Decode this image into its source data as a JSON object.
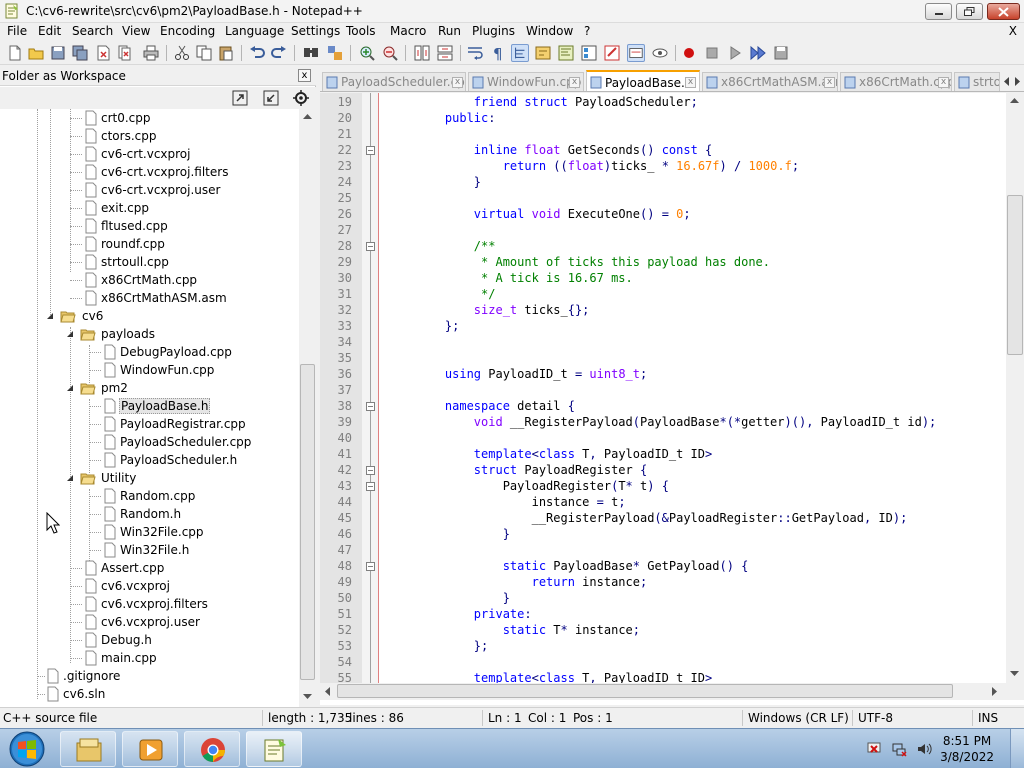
{
  "window": {
    "title": "C:\\cv6-rewrite\\src\\cv6\\pm2\\PayloadBase.h - Notepad++"
  },
  "menu": {
    "items": [
      "File",
      "Edit",
      "Search",
      "View",
      "Encoding",
      "Language",
      "Settings",
      "Tools",
      "Macro",
      "Run",
      "Plugins",
      "Window",
      "?"
    ],
    "close_label": "X"
  },
  "panel": {
    "title": "Folder as Workspace",
    "close_label": "x",
    "tree": [
      {
        "label": "crt0.cpp",
        "type": "file"
      },
      {
        "label": "ctors.cpp",
        "type": "file"
      },
      {
        "label": "cv6-crt.vcxproj",
        "type": "file"
      },
      {
        "label": "cv6-crt.vcxproj.filters",
        "type": "file"
      },
      {
        "label": "cv6-crt.vcxproj.user",
        "type": "file"
      },
      {
        "label": "exit.cpp",
        "type": "file"
      },
      {
        "label": "fltused.cpp",
        "type": "file"
      },
      {
        "label": "roundf.cpp",
        "type": "file"
      },
      {
        "label": "strtoull.cpp",
        "type": "file"
      },
      {
        "label": "x86CrtMath.cpp",
        "type": "file"
      },
      {
        "label": "x86CrtMathASM.asm",
        "type": "file"
      },
      {
        "label": "cv6",
        "type": "folder"
      },
      {
        "label": "payloads",
        "type": "folder"
      },
      {
        "label": "DebugPayload.cpp",
        "type": "file"
      },
      {
        "label": "WindowFun.cpp",
        "type": "file"
      },
      {
        "label": "pm2",
        "type": "folder"
      },
      {
        "label": "PayloadBase.h",
        "type": "file",
        "selected": true
      },
      {
        "label": "PayloadRegistrar.cpp",
        "type": "file"
      },
      {
        "label": "PayloadScheduler.cpp",
        "type": "file"
      },
      {
        "label": "PayloadScheduler.h",
        "type": "file"
      },
      {
        "label": "Utility",
        "type": "folder"
      },
      {
        "label": "Random.cpp",
        "type": "file"
      },
      {
        "label": "Random.h",
        "type": "file"
      },
      {
        "label": "Win32File.cpp",
        "type": "file"
      },
      {
        "label": "Win32File.h",
        "type": "file"
      },
      {
        "label": "Assert.cpp",
        "type": "file"
      },
      {
        "label": "cv6.vcxproj",
        "type": "file"
      },
      {
        "label": "cv6.vcxproj.filters",
        "type": "file"
      },
      {
        "label": "cv6.vcxproj.user",
        "type": "file"
      },
      {
        "label": "Debug.h",
        "type": "file"
      },
      {
        "label": "main.cpp",
        "type": "file"
      },
      {
        "label": ".gitignore",
        "type": "file"
      },
      {
        "label": "cv6.sln",
        "type": "file"
      }
    ]
  },
  "tabs": [
    {
      "label": "PayloadScheduler.cpp",
      "active": false
    },
    {
      "label": "WindowFun.cpp",
      "active": false
    },
    {
      "label": "PayloadBase.h",
      "active": true
    },
    {
      "label": "x86CrtMathASM.asm",
      "active": false
    },
    {
      "label": "x86CrtMath.cpp",
      "active": false
    },
    {
      "label": "strto",
      "active": false
    }
  ],
  "editor": {
    "lines": [
      {
        "n": "19",
        "html": "        <span class=\"kw\">friend</span> <span class=\"kw\">struct</span> PayloadScheduler<span class=\"op\">;</span>"
      },
      {
        "n": "20",
        "html": "    <span class=\"kw\">public</span><span class=\"op\">:</span>"
      },
      {
        "n": "21",
        "html": ""
      },
      {
        "n": "22",
        "html": "        <span class=\"kw\">inline</span> <span class=\"ty\">float</span> GetSeconds<span class=\"op\">()</span> <span class=\"kw\">const</span> <span class=\"op\">{</span>",
        "fold": true
      },
      {
        "n": "23",
        "html": "            <span class=\"kw\">return</span> <span class=\"op\">((</span><span class=\"ty\">float</span><span class=\"op\">)</span>ticks_ <span class=\"op\">*</span> <span class=\"num\">16.67f</span><span class=\"op\">)</span> <span class=\"op\">/</span> <span class=\"num\">1000.f</span><span class=\"op\">;</span>"
      },
      {
        "n": "24",
        "html": "        <span class=\"op\">}</span>"
      },
      {
        "n": "25",
        "html": ""
      },
      {
        "n": "26",
        "html": "        <span class=\"kw\">virtual</span> <span class=\"ty\">void</span> ExecuteOne<span class=\"op\">()</span> <span class=\"op\">=</span> <span class=\"num\">0</span><span class=\"op\">;</span>"
      },
      {
        "n": "27",
        "html": ""
      },
      {
        "n": "28",
        "html": "        <span class=\"cm\">/**</span>",
        "fold": true
      },
      {
        "n": "29",
        "html": "<span class=\"cm\">         * Amount of ticks this payload has done.</span>"
      },
      {
        "n": "30",
        "html": "<span class=\"cm\">         * A tick is 16.67 ms.</span>"
      },
      {
        "n": "31",
        "html": "<span class=\"cm\">         */</span>"
      },
      {
        "n": "32",
        "html": "        <span class=\"ty\">size_t</span> ticks_<span class=\"op\">{};</span>"
      },
      {
        "n": "33",
        "html": "    <span class=\"op\">};</span>"
      },
      {
        "n": "34",
        "html": ""
      },
      {
        "n": "35",
        "html": ""
      },
      {
        "n": "36",
        "html": "    <span class=\"kw\">using</span> PayloadID_t <span class=\"op\">=</span> <span class=\"ty\">uint8_t</span><span class=\"op\">;</span>"
      },
      {
        "n": "37",
        "html": ""
      },
      {
        "n": "38",
        "html": "    <span class=\"kw\">namespace</span> detail <span class=\"op\">{</span>",
        "fold": true
      },
      {
        "n": "39",
        "html": "        <span class=\"ty\">void</span> __RegisterPayload<span class=\"op\">(</span>PayloadBase<span class=\"op\">*(*</span>getter<span class=\"op\">)()</span><span class=\"op\">,</span> PayloadID_t id<span class=\"op\">);</span>"
      },
      {
        "n": "40",
        "html": ""
      },
      {
        "n": "41",
        "html": "        <span class=\"kw\">template</span><span class=\"op\">&lt;</span><span class=\"kw\">class</span> T<span class=\"op\">,</span> PayloadID_t ID<span class=\"op\">&gt;</span>"
      },
      {
        "n": "42",
        "html": "        <span class=\"kw\">struct</span> PayloadRegister <span class=\"op\">{</span>",
        "fold": true
      },
      {
        "n": "43",
        "html": "            PayloadRegister<span class=\"op\">(</span>T<span class=\"op\">*</span> t<span class=\"op\">)</span> <span class=\"op\">{</span>",
        "fold": true
      },
      {
        "n": "44",
        "html": "                instance <span class=\"op\">=</span> t<span class=\"op\">;</span>"
      },
      {
        "n": "45",
        "html": "                __RegisterPayload<span class=\"op\">(&amp;</span>PayloadRegister<span class=\"op\">::</span>GetPayload<span class=\"op\">,</span> ID<span class=\"op\">);</span>"
      },
      {
        "n": "46",
        "html": "            <span class=\"op\">}</span>"
      },
      {
        "n": "47",
        "html": ""
      },
      {
        "n": "48",
        "html": "            <span class=\"kw\">static</span> PayloadBase<span class=\"op\">*</span> GetPayload<span class=\"op\">()</span> <span class=\"op\">{</span>",
        "fold": true
      },
      {
        "n": "49",
        "html": "                <span class=\"kw\">return</span> instance<span class=\"op\">;</span>"
      },
      {
        "n": "50",
        "html": "            <span class=\"op\">}</span>"
      },
      {
        "n": "51",
        "html": "        <span class=\"kw\">private</span><span class=\"op\">:</span>"
      },
      {
        "n": "52",
        "html": "            <span class=\"kw\">static</span> T<span class=\"op\">*</span> instance<span class=\"op\">;</span>"
      },
      {
        "n": "53",
        "html": "        <span class=\"op\">};</span>"
      },
      {
        "n": "54",
        "html": ""
      },
      {
        "n": "55",
        "html": "        <span class=\"kw\">template</span><span class=\"op\">&lt;</span><span class=\"kw\">class</span> T<span class=\"op\">,</span> PayloadID_t ID<span class=\"op\">&gt;</span>"
      }
    ]
  },
  "status": {
    "file_type": "C++ source file",
    "length": "length : 1,735",
    "lines": "lines : 86",
    "ln": "Ln : 1",
    "col": "Col : 1",
    "pos": "Pos : 1",
    "eol": "Windows (CR LF)",
    "encoding": "UTF-8",
    "mode": "INS"
  },
  "taskbar": {
    "time": "8:51 PM",
    "date": "3/8/2022"
  },
  "colors": {
    "keyword": "#0000ff",
    "type": "#8000ff",
    "number": "#ff8000",
    "comment": "#008000",
    "active_tab_accent": "#f7a000"
  }
}
